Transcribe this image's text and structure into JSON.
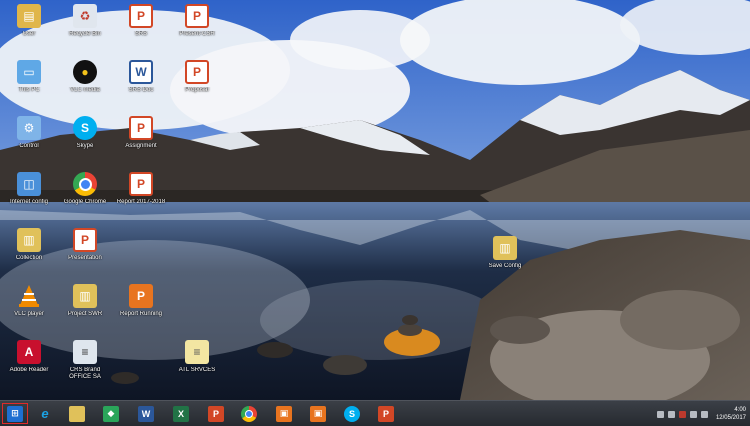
{
  "wallpaper": {
    "sky_top": "#2f63c9",
    "sky_bottom": "#6f98db",
    "cloud": "#f2f4f7",
    "mountain_dark": "#2a2523",
    "snow": "#e8ecf1",
    "lake": "#1c2a3f",
    "shore": "#5a5148"
  },
  "desktop_icons": [
    {
      "label": "User",
      "icon": "user-folder-icon",
      "color": "#e0b64a"
    },
    {
      "label": "Recycle Bin",
      "icon": "recycle-bin-icon",
      "color": "#e0e6ee"
    },
    {
      "label": "SRS",
      "icon": "powerpoint-icon",
      "color": "#d24726"
    },
    {
      "label": "Present-CSR",
      "icon": "powerpoint-icon",
      "color": "#d24726"
    },
    {
      "label": "This PC",
      "icon": "this-pc-icon",
      "color": "#5fa8e6"
    },
    {
      "label": "VLC media",
      "icon": "media-player-icon",
      "color": "#f3c21a"
    },
    {
      "label": "SRS Doc",
      "icon": "word-icon",
      "color": "#2b579a"
    },
    {
      "label": "Proposal",
      "icon": "powerpoint-icon",
      "color": "#d24726"
    },
    {
      "label": "Control",
      "icon": "control-panel-icon",
      "color": "#7fb4e8"
    },
    {
      "label": "Skype",
      "icon": "skype-icon",
      "color": "#00aff0"
    },
    {
      "label": "Assignment",
      "icon": "powerpoint-icon",
      "color": "#d24726"
    },
    {
      "label": "",
      "icon": "empty",
      "color": ""
    },
    {
      "label": "Internet config",
      "icon": "network-icon",
      "color": "#4a90d9"
    },
    {
      "label": "Google Chrome",
      "icon": "chrome-icon",
      "color": "#34a853"
    },
    {
      "label": "Report 2017-2018",
      "icon": "powerpoint-icon",
      "color": "#d24726"
    },
    {
      "label": "",
      "icon": "empty",
      "color": ""
    },
    {
      "label": "Collection",
      "icon": "folder-icon",
      "color": "#e0c15a"
    },
    {
      "label": "Presentation",
      "icon": "powerpoint-icon",
      "color": "#d24726"
    },
    {
      "label": "",
      "icon": "empty",
      "color": ""
    },
    {
      "label": "",
      "icon": "empty",
      "color": ""
    },
    {
      "label": "VLC player",
      "icon": "vlc-icon",
      "color": "#f08a00"
    },
    {
      "label": "Project SWR",
      "icon": "folder-icon",
      "color": "#e0c15a"
    },
    {
      "label": "Report Running",
      "icon": "powerpoint-orange-icon",
      "color": "#e8741f"
    },
    {
      "label": "",
      "icon": "empty",
      "color": ""
    },
    {
      "label": "Adobe Reader",
      "icon": "adobe-reader-icon",
      "color": "#c8102e"
    },
    {
      "label": "CRS Brand OFFICE SA",
      "icon": "document-icon",
      "color": "#dfe6ee"
    },
    {
      "label": "",
      "icon": "empty",
      "color": ""
    },
    {
      "label": "ATL SRVCES",
      "icon": "document-icon",
      "color": "#f3e6a2"
    }
  ],
  "folder_right": {
    "label": "Save Config",
    "icon": "folder-icon",
    "color": "#e0c15a"
  },
  "taskbar": {
    "items": [
      {
        "name": "start-button",
        "icon": "windows-icon",
        "glyph": "⊞",
        "color": "#1e6fd1"
      },
      {
        "name": "internet-explorer",
        "icon": "ie-icon",
        "glyph": "e",
        "color": "#1ba1e2"
      },
      {
        "name": "file-explorer",
        "icon": "folder-icon",
        "glyph": "▬",
        "color": "#e0c15a"
      },
      {
        "name": "store",
        "icon": "store-icon",
        "glyph": "◆",
        "color": "#2aa55a"
      },
      {
        "name": "word",
        "icon": "word-icon",
        "glyph": "W",
        "color": "#2b579a"
      },
      {
        "name": "excel",
        "icon": "excel-icon",
        "glyph": "X",
        "color": "#217346"
      },
      {
        "name": "powerpoint",
        "icon": "powerpoint-icon",
        "glyph": "P",
        "color": "#d24726"
      },
      {
        "name": "chrome",
        "icon": "chrome-icon",
        "glyph": "●",
        "color": "#34a853"
      },
      {
        "name": "app-orange-1",
        "icon": "orange-app-icon",
        "glyph": "▣",
        "color": "#e8741f"
      },
      {
        "name": "app-orange-2",
        "icon": "orange-app-icon",
        "glyph": "▣",
        "color": "#e8741f"
      },
      {
        "name": "skype",
        "icon": "skype-icon",
        "glyph": "S",
        "color": "#00aff0"
      },
      {
        "name": "powerpoint-2",
        "icon": "powerpoint-icon",
        "glyph": "P",
        "color": "#d24726"
      }
    ],
    "clock": {
      "time": "4:00",
      "date": "12/05/2017"
    }
  }
}
